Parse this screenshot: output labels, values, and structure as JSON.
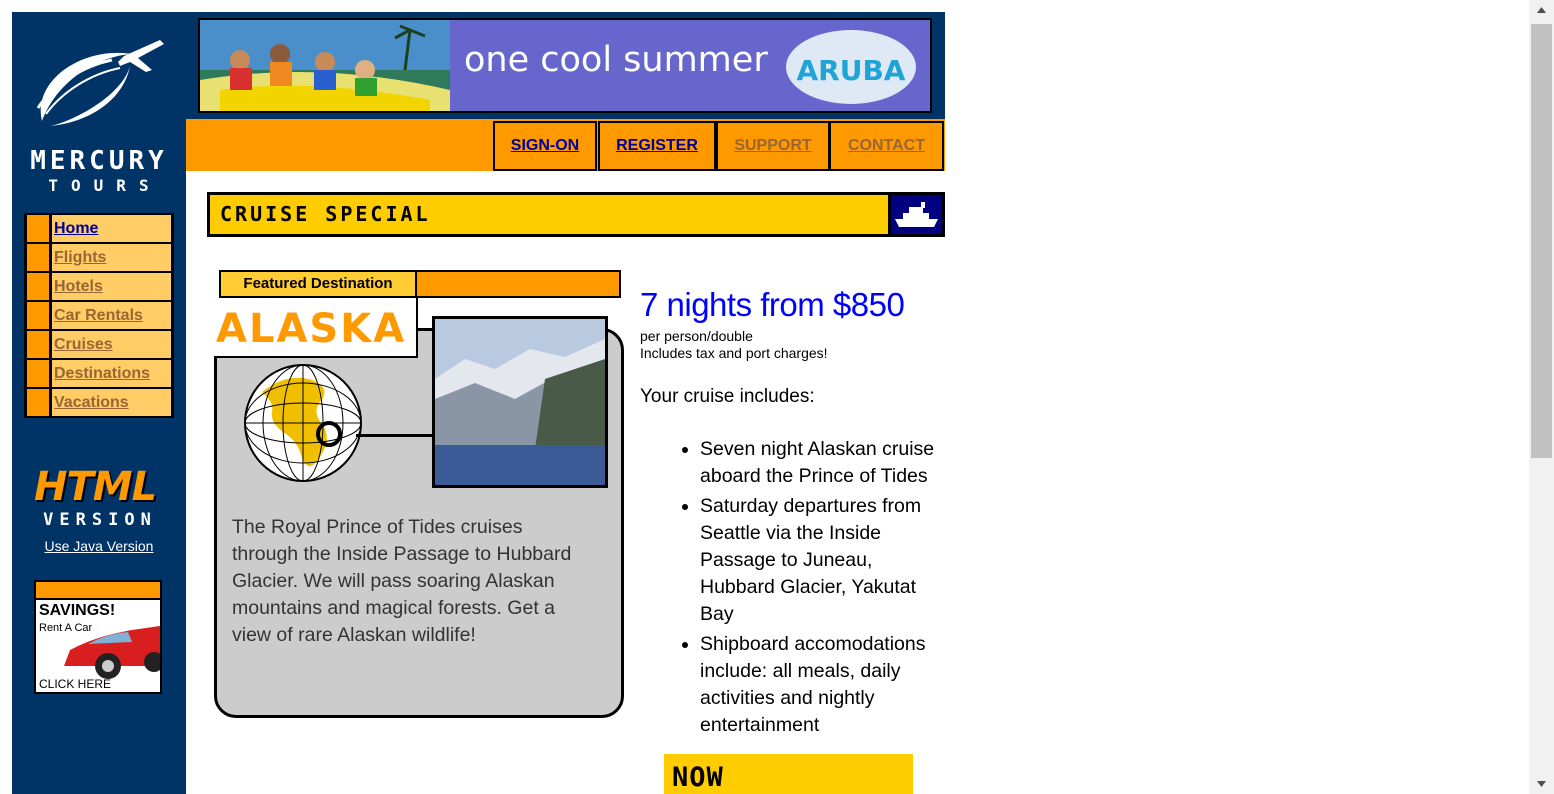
{
  "logo": {
    "line1": "MERCURY",
    "line2": "TOURS"
  },
  "left_nav": [
    {
      "label": "Home",
      "current": true
    },
    {
      "label": "Flights",
      "current": false
    },
    {
      "label": "Hotels",
      "current": false
    },
    {
      "label": "Car Rentals",
      "current": false
    },
    {
      "label": "Cruises",
      "current": false
    },
    {
      "label": "Destinations",
      "current": false
    },
    {
      "label": "Vacations",
      "current": false
    }
  ],
  "html_version": {
    "line1": "HTML",
    "line2": "VERSION",
    "java_link": "Use Java Version"
  },
  "savings_ad": {
    "title": "SAVINGS!",
    "subtitle": "Rent A Car",
    "cta": "CLICK HERE"
  },
  "banner": {
    "slogan": "one cool summer",
    "brand": "ARUBA"
  },
  "top_nav": {
    "signon": "SIGN-ON",
    "register": "REGISTER",
    "support": "SUPPORT",
    "contact": "CONTACT"
  },
  "cruise_special": {
    "label": "CRUISE SPECIAL",
    "icon": "ship-icon"
  },
  "featured": {
    "tab_label": "Featured Destination",
    "destination": "ALASKA",
    "description": "The Royal Prince of Tides cruises through the Inside Passage to Hubbard Glacier. We will pass soaring Alaskan mountains and magical forests. Get a view of rare Alaskan wildlife!"
  },
  "offer": {
    "headline": "7 nights from $850",
    "per_person": "per person/double",
    "taxes": "Includes tax and port charges!",
    "includes_heading": "Your cruise includes:",
    "includes": [
      "Seven night Alaskan cruise aboard the Prince of Tides",
      "Saturday departures from Seattle via the Inside Passage to Juneau, Hubbard Glacier, Yakutat Bay",
      "Shipboard accomodations include: all meals, daily activities and nightly entertainment"
    ]
  },
  "now_banner": {
    "text": "NOW"
  },
  "colors": {
    "navy": "#003366",
    "orange": "#ff9900",
    "yellow": "#ffcc00",
    "link_blue": "#000099",
    "link_brown": "#996633",
    "price_blue": "#0000ff"
  }
}
